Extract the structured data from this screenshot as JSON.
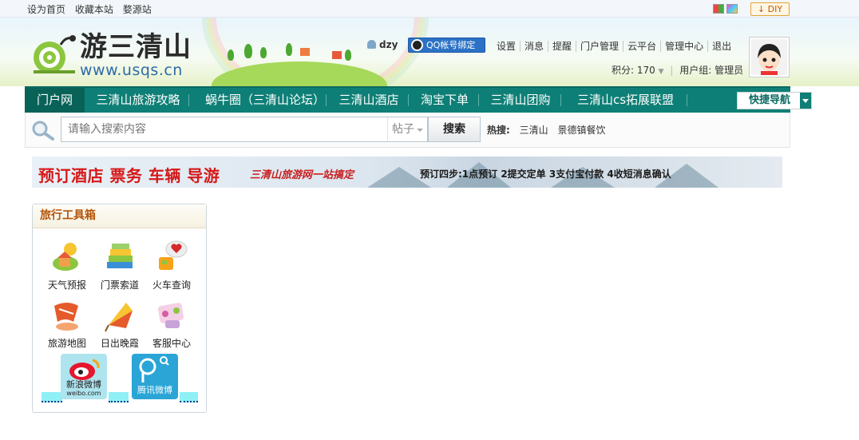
{
  "topbar": {
    "links": [
      "设为首页",
      "收藏本站",
      "婺源站"
    ],
    "diy_label": "DIY"
  },
  "header": {
    "logo_text": "游三清山",
    "logo_url": "www.usqs.cn",
    "user": {
      "name": "dzy",
      "qq_button": "QQ帐号绑定",
      "links": [
        "设置",
        "消息",
        "提醒",
        "门户管理",
        "云平台",
        "管理中心",
        "退出"
      ],
      "score_label": "积分: 170",
      "usergroup_label": "用户组: 管理员"
    }
  },
  "nav": {
    "items": [
      "门户网",
      "三清山旅游攻略",
      "蜗牛圈（三清山论坛）",
      "三清山酒店",
      "淘宝下单",
      "三清山团购",
      "三清山cs拓展联盟"
    ],
    "active_index": 0,
    "quick_nav": "快捷导航"
  },
  "search": {
    "placeholder": "请输入搜索内容",
    "type_selected": "帖子",
    "button": "搜索",
    "hot_label": "热搜:",
    "hot_items": [
      "三清山",
      "景德镇餐饮"
    ]
  },
  "banner": {
    "main_text": "预订酒店  票务  车辆  导游",
    "slogan": "三清山旅游网一站搞定",
    "steps": "预订四步:1点预订  2提交定单  3支付宝付款  4收短消息确认"
  },
  "toolbox": {
    "title": "旅行工具箱",
    "tools": [
      "天气预报",
      "门票索道",
      "火车查询",
      "旅游地图",
      "日出晚霞",
      "客服中心"
    ],
    "weibo": [
      {
        "label": "新浪微博",
        "sub": "weibo.com"
      },
      {
        "label": "腾讯微博"
      }
    ]
  },
  "colors": {
    "nav_bg": "#0e7f76",
    "nav_active": "#086258",
    "banner_red": "#d51818",
    "toolbox_title": "#b5540a"
  }
}
